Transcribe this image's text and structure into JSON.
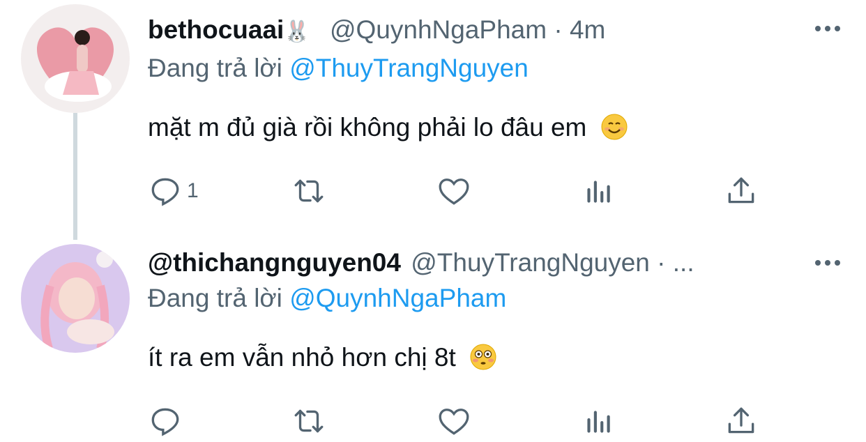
{
  "tweets": [
    {
      "display_name": "bethocuaai",
      "name_emoji": "🐰",
      "handle": "@QuynhNgaPham",
      "separator": "·",
      "time": "4m",
      "reply_prefix": "Đang trả lời",
      "reply_to": "@ThuyTrangNguyen",
      "text": "mặt m đủ già rồi không phải lo đâu em",
      "text_emoji": "😊",
      "reply_count": "1"
    },
    {
      "display_name": "@thichangnguyen04",
      "handle": "@ThuyTrangNguyen",
      "separator": "·",
      "time": "...",
      "reply_prefix": "Đang trả lời",
      "reply_to": "@QuynhNgaPham",
      "text": "ít ra em vẫn nhỏ hơn chị 8t",
      "text_emoji": "😳",
      "reply_count": ""
    }
  ],
  "colors": {
    "link": "#1d9bf0",
    "muted": "#536471",
    "thread_line": "#cfd9de"
  },
  "icons": [
    "reply-icon",
    "retweet-icon",
    "like-icon",
    "analytics-icon",
    "share-icon",
    "more-options-icon"
  ]
}
